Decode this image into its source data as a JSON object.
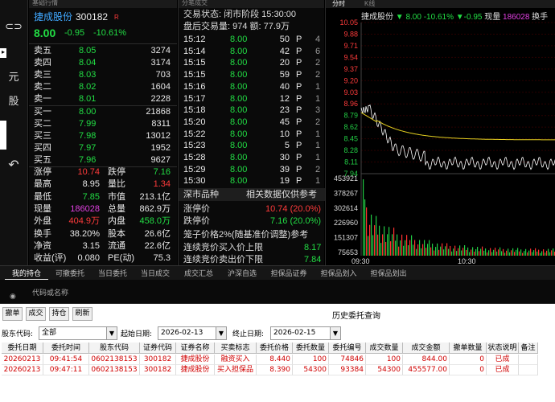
{
  "left_toolbar": {
    "items": [
      {
        "icon": "connect-icon",
        "glyph": "⊂⊃"
      },
      {
        "icon": "arrow-icon",
        "glyph": "▸"
      },
      {
        "label": "元"
      },
      {
        "label": "股"
      },
      {
        "icon": "back-icon",
        "glyph": "↶"
      }
    ]
  },
  "quote": {
    "header": "基础行情",
    "name": "捷成股份",
    "code": "300182",
    "tag": "R",
    "price": "8.00",
    "change": "-0.95",
    "pct": "-10.61%",
    "asks": [
      {
        "label": "卖五",
        "price": "8.05",
        "vol": "3274"
      },
      {
        "label": "卖四",
        "price": "8.04",
        "vol": "3174"
      },
      {
        "label": "卖三",
        "price": "8.03",
        "vol": "703"
      },
      {
        "label": "卖二",
        "price": "8.02",
        "vol": "1604"
      },
      {
        "label": "卖一",
        "price": "8.01",
        "vol": "2228"
      }
    ],
    "bids": [
      {
        "label": "买一",
        "price": "8.00",
        "vol": "21868"
      },
      {
        "label": "买二",
        "price": "7.99",
        "vol": "8311"
      },
      {
        "label": "买三",
        "price": "7.98",
        "vol": "13012"
      },
      {
        "label": "买四",
        "price": "7.97",
        "vol": "1952"
      },
      {
        "label": "买五",
        "price": "7.96",
        "vol": "9627"
      }
    ],
    "stats": [
      {
        "l1": "涨停",
        "v1": "10.74",
        "c1": "red",
        "l2": "跌停",
        "v2": "7.16",
        "c2": "green"
      },
      {
        "l1": "最高",
        "v1": "8.95",
        "c1": "white",
        "l2": "量比",
        "v2": "1.34",
        "c2": "red"
      },
      {
        "l1": "最低",
        "v1": "7.85",
        "c1": "green",
        "l2": "市值",
        "v2": "213.1亿",
        "c2": "white"
      },
      {
        "l1": "现量",
        "v1": "186028",
        "c1": "mag",
        "l2": "总量",
        "v2": "862.9万",
        "c2": "white"
      },
      {
        "l1": "外盘",
        "v1": "404.9万",
        "c1": "red",
        "l2": "内盘",
        "v2": "458.0万",
        "c2": "green"
      },
      {
        "l1": "换手",
        "v1": "38.20%",
        "c1": "white",
        "l2": "股本",
        "v2": "26.6亿",
        "c2": "white"
      },
      {
        "l1": "净资",
        "v1": "3.15",
        "c1": "white",
        "l2": "流通",
        "v2": "22.6亿",
        "c2": "white"
      },
      {
        "l1": "收益(评)",
        "v1": "0.080",
        "c1": "white",
        "l2": "PE(动)",
        "v2": "75.3",
        "c2": "white"
      }
    ]
  },
  "trades": {
    "header": "分笔成交",
    "status": "交易状态: 闭市阶段 15:30:00",
    "summary": "盘后交易量: 974  额: 77.9万",
    "rows": [
      {
        "t": "15:12",
        "p": "8.00",
        "v": "50",
        "d": "P",
        "n": "4"
      },
      {
        "t": "15:14",
        "p": "8.00",
        "v": "42",
        "d": "P",
        "n": "6"
      },
      {
        "t": "15:15",
        "p": "8.00",
        "v": "20",
        "d": "P",
        "n": "2"
      },
      {
        "t": "15:15",
        "p": "8.00",
        "v": "59",
        "d": "P",
        "n": "2"
      },
      {
        "t": "15:16",
        "p": "8.00",
        "v": "40",
        "d": "P",
        "n": "1"
      },
      {
        "t": "15:17",
        "p": "8.00",
        "v": "12",
        "d": "P",
        "n": "1"
      },
      {
        "t": "15:18",
        "p": "8.00",
        "v": "23",
        "d": "P",
        "n": "3"
      },
      {
        "t": "15:20",
        "p": "8.00",
        "v": "45",
        "d": "P",
        "n": "2"
      },
      {
        "t": "15:22",
        "p": "8.00",
        "v": "10",
        "d": "P",
        "n": "1"
      },
      {
        "t": "15:23",
        "p": "8.00",
        "v": "5",
        "d": "P",
        "n": "1"
      },
      {
        "t": "15:28",
        "p": "8.00",
        "v": "30",
        "d": "P",
        "n": "1"
      },
      {
        "t": "15:29",
        "p": "8.00",
        "v": "39",
        "d": "P",
        "n": "2"
      },
      {
        "t": "15:30",
        "p": "8.00",
        "v": "19",
        "d": "P",
        "n": "1"
      }
    ],
    "sector_label": "深市品种",
    "sector_note": "相关数据仅供参考",
    "limits": [
      {
        "label": "涨停价",
        "value": "10.74 (20.0%)",
        "color": "red"
      },
      {
        "label": "跌停价",
        "value": "7.16 (20.0%)",
        "color": "green"
      }
    ],
    "cage_title": "笼子价格2%(随基准价调整)参考",
    "cage": [
      {
        "label": "连续竞价买入价上限",
        "value": "8.17",
        "color": "green"
      },
      {
        "label": "连续竞价卖出价下限",
        "value": "7.84",
        "color": "green"
      }
    ]
  },
  "chart": {
    "tabs": [
      "分时",
      "K线"
    ],
    "title": "捷成股份",
    "price": "8.00",
    "pct": "-10.61%",
    "chg": "-0.95",
    "vol_label": "现量",
    "vol": "186028",
    "extra": "换手",
    "price_ticks": [
      "10.05",
      "9.88",
      "9.71",
      "9.54",
      "9.37",
      "9.20",
      "9.03",
      "8.96",
      "8.79",
      "8.62",
      "8.45",
      "8.28",
      "8.11",
      "7.94"
    ],
    "vol_ticks": [
      "453921",
      "378267",
      "302614",
      "226960",
      "151307",
      "75653"
    ],
    "time_ticks": [
      "09:30",
      "10:30"
    ],
    "colors": {
      "avg_line": "#e6d020",
      "price_line": "#ffffff",
      "up": "#ff3030",
      "down": "#22cc44"
    }
  },
  "bottom_tabs": [
    "我的持仓",
    "可撤委托",
    "当日委托",
    "当日成交",
    "成交汇总",
    "沪深自选",
    "担保品证券",
    "担保品划入",
    "担保品划出"
  ],
  "codebar": {
    "label": "代码或名称"
  },
  "history": {
    "buttons": [
      "撤单",
      "成交",
      "持仓",
      "刷新"
    ],
    "title": "历史委托查询",
    "holder_label": "股东代码:",
    "holder_value": "全部",
    "start_label": "起始日期:",
    "start_value": "2026-02-13",
    "end_label": "终止日期:",
    "end_value": "2026-02-15",
    "columns": [
      "委托日期",
      "委托时间",
      "股东代码",
      "证券代码",
      "证券名称",
      "买卖标志",
      "委托价格",
      "委托数量",
      "委托编号",
      "成交数量",
      "成交金额",
      "撤单数量",
      "状态说明",
      "备注"
    ],
    "rows": [
      [
        "20260213",
        "09:41:54",
        "0602138153",
        "300182",
        "捷成股份",
        "融资买入",
        "8.440",
        "100",
        "74846",
        "100",
        "844.00",
        "0",
        "已成",
        ""
      ],
      [
        "20260213",
        "09:47:11",
        "0602138153",
        "300182",
        "捷成股份",
        "买入担保品",
        "8.390",
        "54300",
        "93384",
        "54300",
        "455577.00",
        "0",
        "已成",
        ""
      ]
    ]
  }
}
